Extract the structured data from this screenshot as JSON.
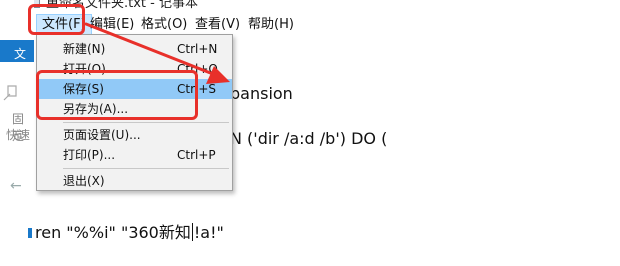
{
  "window": {
    "title": "重命名文件夹.txt - 记事本"
  },
  "menubar": {
    "file": "文件(F)",
    "edit": "编辑(E)",
    "format": "格式(O)",
    "view": "查看(V)",
    "help": "帮助(H)"
  },
  "explorer": {
    "ribbon_tab": "文",
    "pin": "固定",
    "quick": "快速"
  },
  "file_menu": {
    "items": [
      {
        "label": "新建(N)",
        "shortcut": "Ctrl+N"
      },
      {
        "label": "打开(O)...",
        "shortcut": "Ctrl+O"
      },
      {
        "label": "保存(S)",
        "shortcut": "Ctrl+S"
      },
      {
        "label": "另存为(A)...",
        "shortcut": ""
      },
      {
        "label": "页面设置(U)...",
        "shortcut": ""
      },
      {
        "label": "打印(P)...",
        "shortcut": "Ctrl+P"
      },
      {
        "label": "退出(X)",
        "shortcut": ""
      }
    ],
    "highlighted": "保存(S)"
  },
  "editor": {
    "line1_tail": "pansion",
    "line2_tail": "N ('dir /a:d /b') DO (",
    "line3_before_caret": "ren \"%%i\" \"360新知",
    "line3_after_caret": "!a!\""
  },
  "annotation": {
    "color": "#e8302a"
  }
}
